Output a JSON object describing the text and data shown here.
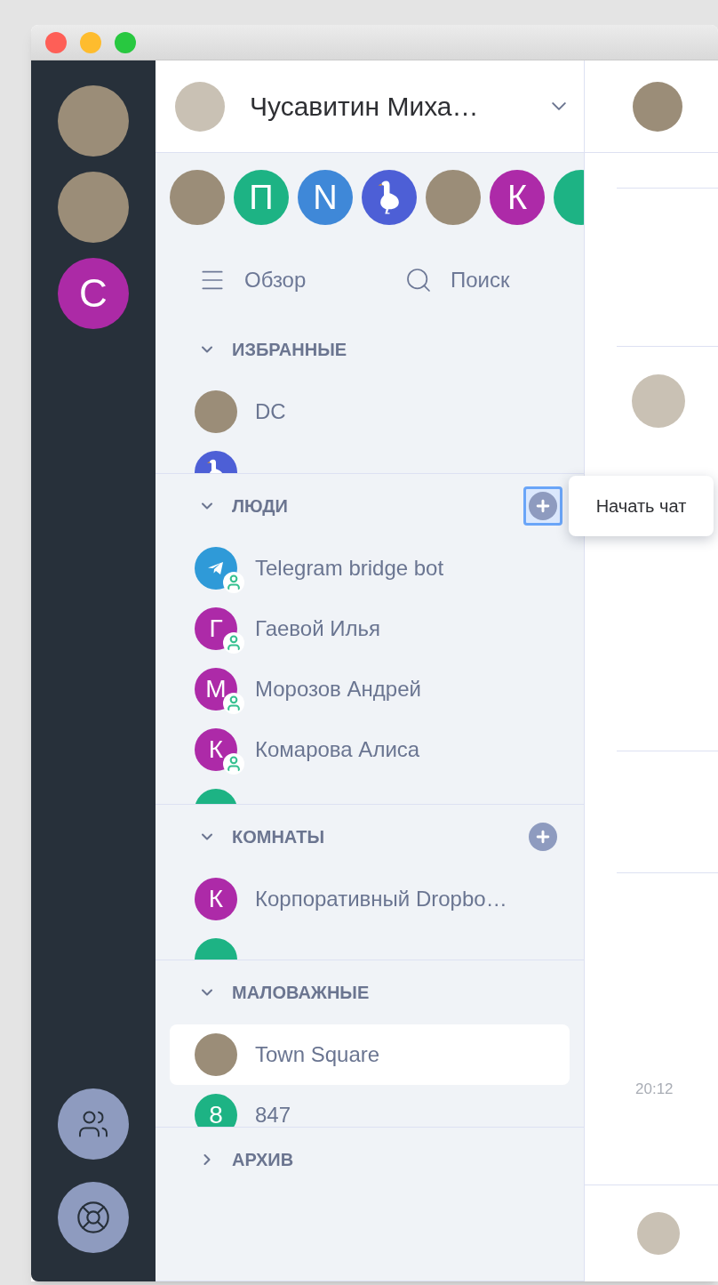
{
  "window": {
    "traffic_lights": [
      {
        "color": "#fe5f57"
      },
      {
        "color": "#febc2e"
      },
      {
        "color": "#28c840"
      }
    ]
  },
  "spaces": [
    {
      "kind": "photo"
    },
    {
      "kind": "photo"
    },
    {
      "kind": "letter",
      "letter": "С",
      "color": "#ac2aa6"
    }
  ],
  "account": {
    "name": "Чусавитин Миха…"
  },
  "recent": [
    {
      "kind": "photo"
    },
    {
      "kind": "letter",
      "letter": "П",
      "color": "#1db384"
    },
    {
      "kind": "letter",
      "letter": "N",
      "color": "#3f88d8"
    },
    {
      "kind": "goose",
      "color": "#4d5fd6"
    },
    {
      "kind": "photo"
    },
    {
      "kind": "letter",
      "letter": "К",
      "color": "#ad2aa8"
    },
    {
      "kind": "letter",
      "color": "#1db384"
    }
  ],
  "nav": [
    {
      "kind": "menu",
      "label": "Обзор"
    },
    {
      "kind": "search",
      "label": "Поиск"
    }
  ],
  "sections": [
    {
      "title": "ИЗБРАННЫЕ",
      "expanded": true,
      "items": [
        {
          "name": "DC",
          "avatar": {
            "kind": "photo"
          },
          "dm": false,
          "selected": false
        }
      ],
      "partial_avatar": {
        "kind": "goose",
        "color": "#4d5fd6"
      }
    },
    {
      "title": "ЛЮДИ",
      "expanded": true,
      "add_button": {
        "focused": true
      },
      "items": [
        {
          "name": "Telegram bridge bot",
          "avatar": {
            "kind": "telegram",
            "color": "#2f9ad8"
          },
          "dm": true,
          "selected": false
        },
        {
          "name": "Гаевой Илья",
          "avatar": {
            "kind": "letter",
            "letter": "Г",
            "color": "#ad2aa8"
          },
          "dm": true,
          "selected": false
        },
        {
          "name": "Морозов Андрей",
          "avatar": {
            "kind": "letter",
            "letter": "М",
            "color": "#ad2aa8"
          },
          "dm": true,
          "selected": false
        },
        {
          "name": "Комарова Алиса",
          "avatar": {
            "kind": "letter",
            "letter": "К",
            "color": "#ad2aa8"
          },
          "dm": true,
          "selected": false
        }
      ],
      "partial_avatar": {
        "kind": "letter",
        "color": "#1db384"
      }
    },
    {
      "title": "КОМНАТЫ",
      "expanded": true,
      "add_button": {
        "focused": false
      },
      "items": [
        {
          "name": "Корпоративный Dropbo…",
          "avatar": {
            "kind": "letter",
            "letter": "К",
            "color": "#ad2aa8"
          },
          "dm": false,
          "selected": false
        }
      ],
      "partial_avatar": {
        "kind": "letter",
        "color": "#1db384"
      }
    },
    {
      "title": "МАЛОВАЖНЫЕ",
      "expanded": true,
      "items": [
        {
          "name": "Town Square",
          "avatar": {
            "kind": "photo"
          },
          "dm": false,
          "selected": true
        },
        {
          "name": "847",
          "avatar": {
            "kind": "letter",
            "letter": "8",
            "color": "#1db384"
          },
          "dm": false,
          "selected": false
        }
      ]
    },
    {
      "title": "АРХИВ",
      "expanded": false
    }
  ],
  "tooltip": {
    "text": "Начать чат"
  },
  "chat": {
    "time": "20:12"
  }
}
